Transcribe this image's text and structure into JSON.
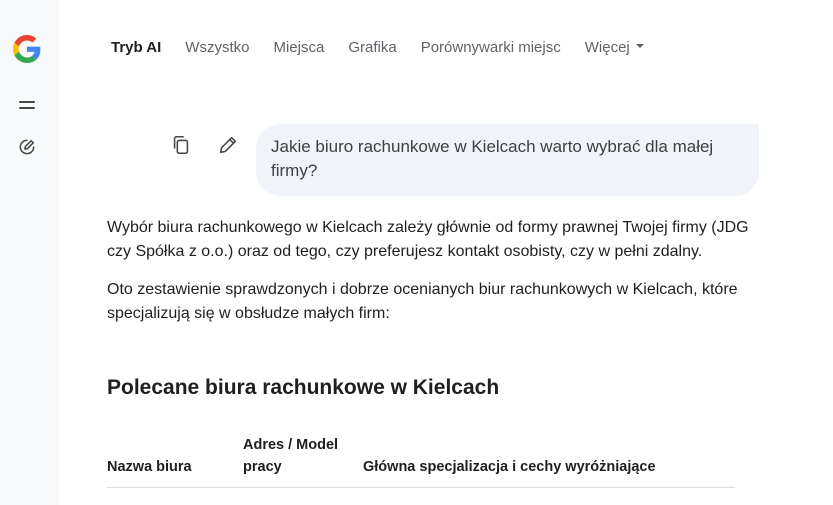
{
  "nav": {
    "tabs": [
      {
        "label": "Tryb AI"
      },
      {
        "label": "Wszystko"
      },
      {
        "label": "Miejsca"
      },
      {
        "label": "Grafika"
      },
      {
        "label": "Porównywarki miejsc"
      },
      {
        "label": "Więcej"
      }
    ]
  },
  "query": {
    "text": "Jakie biuro rachunkowe w Kielcach warto wybrać dla małej firmy?"
  },
  "answer": {
    "paragraph1": "Wybór biura rachunkowego w Kielcach zależy głównie od formy prawnej Twojej firmy (JDG czy Spółka z o.o.) oraz od tego, czy preferujesz kontakt osobisty, czy w pełni zdalny.",
    "paragraph2": "Oto zestawienie sprawdzonych i dobrze ocenianych biur rachunkowych w Kielcach, które specjalizują się w obsłudze małych firm:",
    "heading": "Polecane biura rachunkowe w Kielcach"
  },
  "table": {
    "headers": [
      "Nazwa biura",
      "Adres / Model pracy",
      "Główna specjalizacja i cechy wyróżniające"
    ]
  },
  "icons": {
    "logo": "google-g-icon",
    "menu": "menu-icon",
    "new_chat": "edit-icon",
    "copy": "copy-icon",
    "edit": "pencil-icon"
  },
  "colors": {
    "rail_bg": "#f8f9fa",
    "bubble_bg": "#f0f4f9",
    "active_tab": "#1f1f1f",
    "inactive_tab": "#5f6368"
  }
}
